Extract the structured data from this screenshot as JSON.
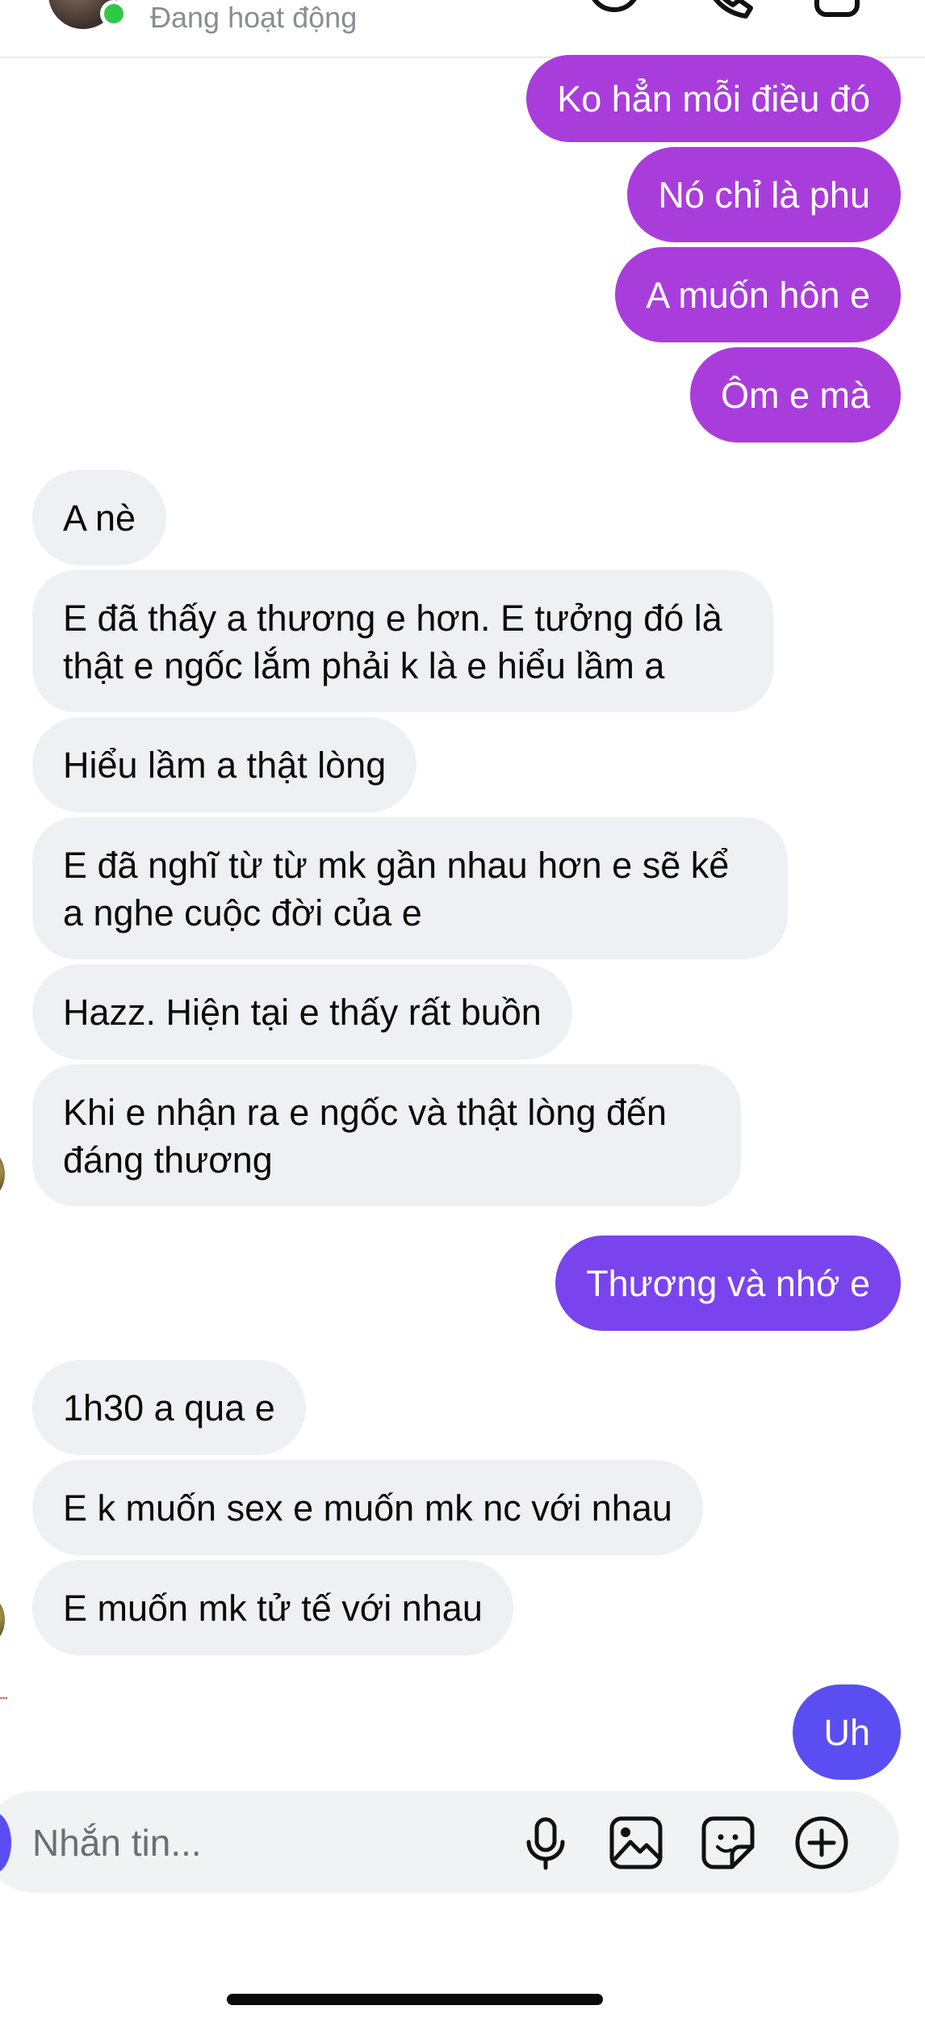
{
  "header": {
    "status": "Đang hoạt động",
    "icons": [
      "avatar",
      "online-dot",
      "sticker-icon",
      "phone-icon",
      "video-icon"
    ]
  },
  "messages": [
    {
      "side": "outgoing",
      "text": "Ko hẳn mỗi điều đó",
      "color": "#a93ddc"
    },
    {
      "side": "outgoing",
      "text": "Nó chỉ là phu",
      "color": "#a93ddc"
    },
    {
      "side": "outgoing",
      "text": "A muốn hôn e",
      "color": "#a93ddc"
    },
    {
      "side": "outgoing",
      "text": "Ôm e mà",
      "color": "#a93ddc"
    },
    {
      "side": "incoming",
      "text": "A nè"
    },
    {
      "side": "incoming",
      "text": "E đã thấy a thương e hơn. E tưởng đó là thật e ngốc lắm phải k là e hiểu lầm a"
    },
    {
      "side": "incoming",
      "text": "Hiểu lầm a thật lòng"
    },
    {
      "side": "incoming",
      "text": "E đã nghĩ từ từ mk gần nhau hơn e sẽ kể a nghe cuộc đời của e"
    },
    {
      "side": "incoming",
      "text": "Hazz. Hiện tại e thấy rất buồn"
    },
    {
      "side": "incoming",
      "text": "Khi e nhận ra e ngốc và thật lòng đến đáng thương"
    },
    {
      "side": "outgoing",
      "text": "Thương và nhớ e",
      "color": "#7944ee"
    },
    {
      "side": "incoming",
      "text": "1h30 a qua e"
    },
    {
      "side": "incoming",
      "text": "E k muốn sex e muốn mk nc với nhau"
    },
    {
      "side": "incoming",
      "text": "E muốn mk tử tế với nhau"
    },
    {
      "side": "outgoing",
      "text": "Uh",
      "color": "#5a4ef2"
    }
  ],
  "composer": {
    "placeholder": "Nhắn tin...",
    "icons": [
      "microphone-icon",
      "image-icon",
      "sticker-icon",
      "add-icon"
    ]
  },
  "colors": {
    "outgoing_purple": "#a93ddc",
    "outgoing_violet": "#7944ee",
    "outgoing_blue": "#5a4ef2",
    "incoming_bg": "#eef0f3",
    "online": "#31c848"
  }
}
